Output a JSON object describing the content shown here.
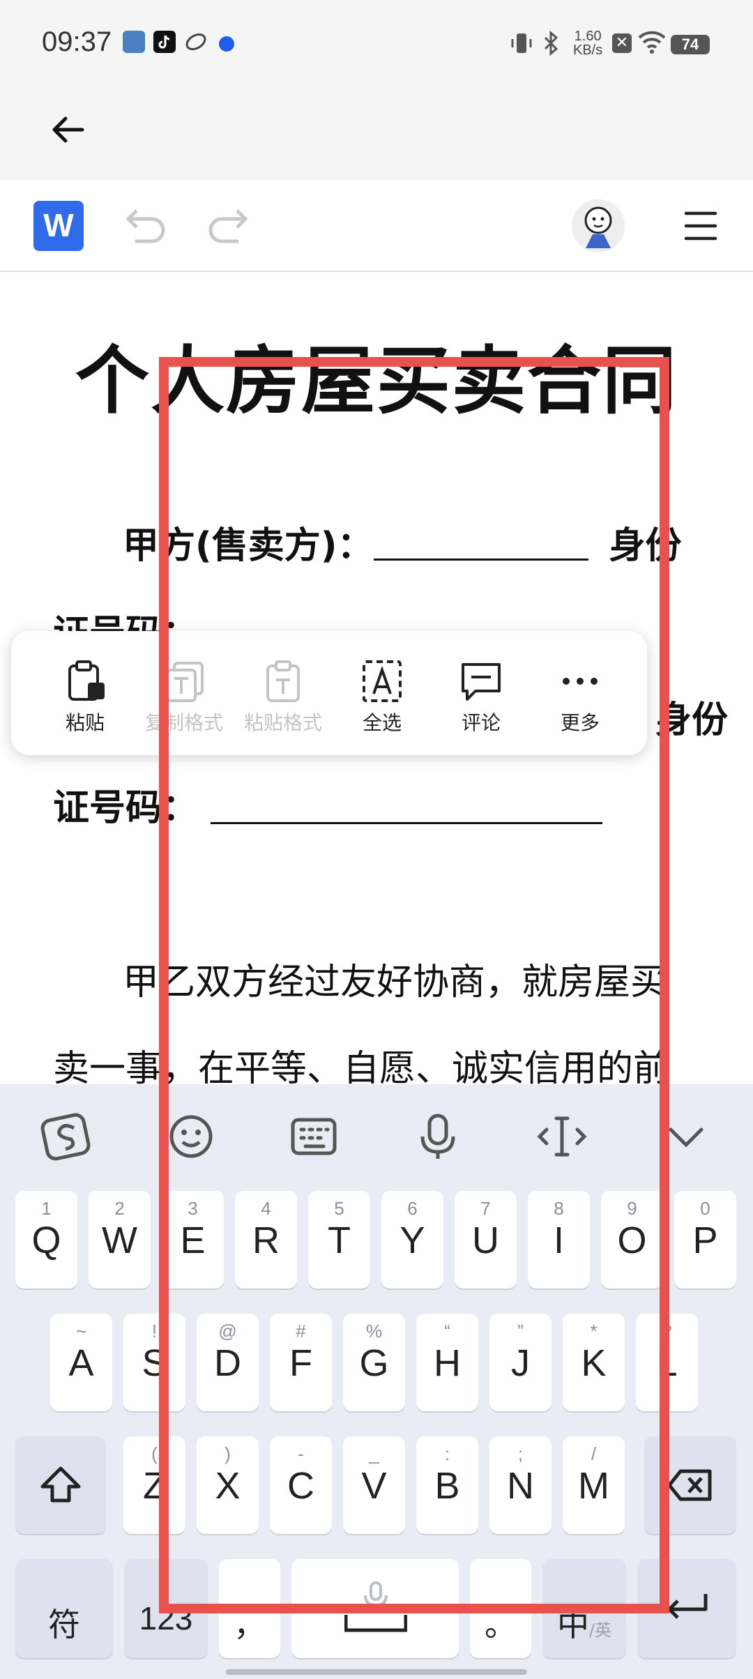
{
  "status_bar": {
    "time": "09:37",
    "net_speed_value": "1.60",
    "net_speed_unit": "KB/s",
    "battery": "74"
  },
  "document": {
    "title": "个人房屋买卖合同",
    "line1_label": "甲方(售卖方)：",
    "line1_suffix": "身份",
    "line2": "证号码：",
    "line3_suffix": "身份",
    "line4_label": "证号码：",
    "para1": "甲乙双方经过友好协商，就房屋买",
    "para2": "卖一事，在平等、自愿、诚实信用的前"
  },
  "context_menu": {
    "items": [
      {
        "label": "粘贴",
        "enabled": true,
        "icon": "paste-icon"
      },
      {
        "label": "复制格式",
        "enabled": false,
        "icon": "copy-format-icon"
      },
      {
        "label": "粘贴格式",
        "enabled": false,
        "icon": "paste-format-icon"
      },
      {
        "label": "全选",
        "enabled": true,
        "icon": "select-all-icon"
      },
      {
        "label": "评论",
        "enabled": true,
        "icon": "comment-icon"
      },
      {
        "label": "更多",
        "enabled": true,
        "icon": "more-icon"
      }
    ]
  },
  "keyboard": {
    "row1": [
      {
        "main": "Q",
        "sub": "1"
      },
      {
        "main": "W",
        "sub": "2"
      },
      {
        "main": "E",
        "sub": "3"
      },
      {
        "main": "R",
        "sub": "4"
      },
      {
        "main": "T",
        "sub": "5"
      },
      {
        "main": "Y",
        "sub": "6"
      },
      {
        "main": "U",
        "sub": "7"
      },
      {
        "main": "I",
        "sub": "8"
      },
      {
        "main": "O",
        "sub": "9"
      },
      {
        "main": "P",
        "sub": "0"
      }
    ],
    "row2": [
      {
        "main": "A",
        "sub": "~"
      },
      {
        "main": "S",
        "sub": "!"
      },
      {
        "main": "D",
        "sub": "@"
      },
      {
        "main": "F",
        "sub": "#"
      },
      {
        "main": "G",
        "sub": "%"
      },
      {
        "main": "H",
        "sub": "“"
      },
      {
        "main": "J",
        "sub": "”"
      },
      {
        "main": "K",
        "sub": "*"
      },
      {
        "main": "L",
        "sub": "?"
      }
    ],
    "row3": [
      {
        "main": "Z",
        "sub": "("
      },
      {
        "main": "X",
        "sub": ")"
      },
      {
        "main": "C",
        "sub": "-"
      },
      {
        "main": "V",
        "sub": "_"
      },
      {
        "main": "B",
        "sub": ":"
      },
      {
        "main": "N",
        "sub": ";"
      },
      {
        "main": "M",
        "sub": "/"
      }
    ],
    "symbols_key": "符",
    "numbers_key": "123",
    "comma_key": "，",
    "period_key": "。",
    "lang_key": "中",
    "lang_key_sub": "/英"
  },
  "colors": {
    "highlight": "#e8514c",
    "word_blue": "#2f6bea",
    "keyboard_bg": "#e9ecf5"
  }
}
